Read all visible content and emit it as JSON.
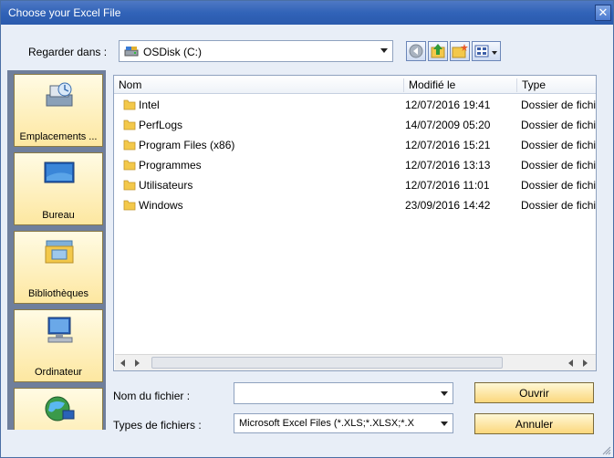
{
  "dialog": {
    "title": "Choose your Excel File",
    "close_glyph": "✕"
  },
  "lookin": {
    "label": "Regarder dans :",
    "value": "OSDisk (C:)",
    "drive_icon": "hard-drive-icon"
  },
  "toolbar": {
    "buttons": [
      "back-icon",
      "up-folder-icon",
      "new-folder-icon",
      "view-menu-icon"
    ]
  },
  "places": [
    {
      "label": "Emplacements ...",
      "icon": "recent-places-icon"
    },
    {
      "label": "Bureau",
      "icon": "desktop-icon"
    },
    {
      "label": "Bibliothèques",
      "icon": "libraries-icon"
    },
    {
      "label": "Ordinateur",
      "icon": "computer-icon"
    },
    {
      "label": "",
      "icon": "network-icon"
    }
  ],
  "filelist": {
    "columns": [
      "Nom",
      "Modifié le",
      "Type"
    ],
    "rows": [
      {
        "name": "Intel",
        "modified": "12/07/2016 19:41",
        "type": "Dossier de fichiers"
      },
      {
        "name": "PerfLogs",
        "modified": "14/07/2009 05:20",
        "type": "Dossier de fichiers"
      },
      {
        "name": "Program Files (x86)",
        "modified": "12/07/2016 15:21",
        "type": "Dossier de fichiers"
      },
      {
        "name": "Programmes",
        "modified": "12/07/2016 13:13",
        "type": "Dossier de fichiers"
      },
      {
        "name": "Utilisateurs",
        "modified": "12/07/2016 11:01",
        "type": "Dossier de fichiers"
      },
      {
        "name": "Windows",
        "modified": "23/09/2016 14:42",
        "type": "Dossier de fichiers"
      }
    ]
  },
  "filename": {
    "label": "Nom du fichier :",
    "value": "",
    "placeholder": ""
  },
  "filetype": {
    "label": "Types de fichiers :",
    "value": "Microsoft Excel Files (*.XLS;*.XLSX;*.X"
  },
  "buttons": {
    "open": "Ouvrir",
    "cancel": "Annuler"
  },
  "colors": {
    "titlebar": "#3163b8",
    "button_gold": "#fbd77c",
    "places_bg": "#6f7f9c"
  }
}
